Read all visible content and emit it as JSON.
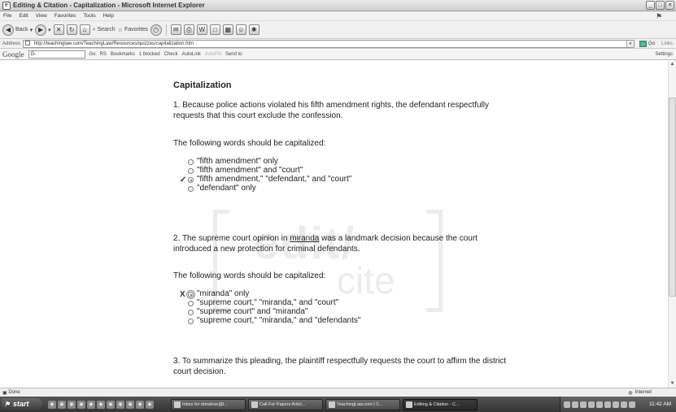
{
  "window": {
    "title": "Editing & Citation - Capitalization - Microsoft Internet Explorer",
    "controls": {
      "minimize": "_",
      "maximize": "□",
      "close": "✕"
    }
  },
  "menu": [
    "File",
    "Edit",
    "View",
    "Favorites",
    "Tools",
    "Help"
  ],
  "toolbar": {
    "back": "Back",
    "search": "Search",
    "favorites": "Favorites"
  },
  "address": {
    "label": "Address",
    "url": "http://teachinglaw.com/TeachingLaw/Resources/quizzes/capitalization.htm",
    "go": "Go",
    "links": "Links"
  },
  "googlebar": {
    "logo": "Google",
    "search_prefix": "G-",
    "items": [
      "Go",
      "RS",
      "Bookmarks",
      "1 blocked",
      "Check",
      "AutoLink",
      "AutoFill",
      "Send to"
    ],
    "settings": "Settings"
  },
  "page": {
    "heading": "Capitalization",
    "q1": {
      "text": "1. Because police actions violated his fifth amendment rights, the defendant respectfully requests that this court exclude the confession.",
      "prompt": "The following words should be capitalized:",
      "options": [
        "\"fifth amendment\" only",
        "\"fifth amendment\" and \"court\"",
        "\"fifth amendment,\" \"defendant,\" and \"court\"",
        "\"defendant\" only"
      ],
      "selected_index": 2,
      "result_mark": "✓"
    },
    "q2": {
      "text_before": "2. The supreme court opinion in ",
      "underlined": "miranda",
      "text_after": " was a landmark decision because the court introduced a new protection for criminal defendants.",
      "prompt": "The following words should be capitalized:",
      "options": [
        "\"miranda\" only",
        "\"supreme court,\" \"miranda,\" and \"court\"",
        "\"supreme court\" and \"miranda\"",
        "\"supreme court,\" \"miranda,\" and \"defendants\""
      ],
      "selected_index": 0,
      "result_mark": "X"
    },
    "q3": {
      "text": "3. To summarize this pleading, the plaintiff respectfully requests the court to affirm the district court decision."
    },
    "watermark": {
      "line1": "edit/",
      "line2": "cite"
    }
  },
  "status": {
    "left": "Done",
    "zone": "Internet"
  },
  "taskbar": {
    "start": "start",
    "tasks": [
      "Inbox for donahoe@l...",
      "Call For Papers Articl...",
      "TeachingLaw.com | C...",
      "Editing & Citation - C..."
    ],
    "active_task_index": 3,
    "clock": "11:42 AM"
  }
}
